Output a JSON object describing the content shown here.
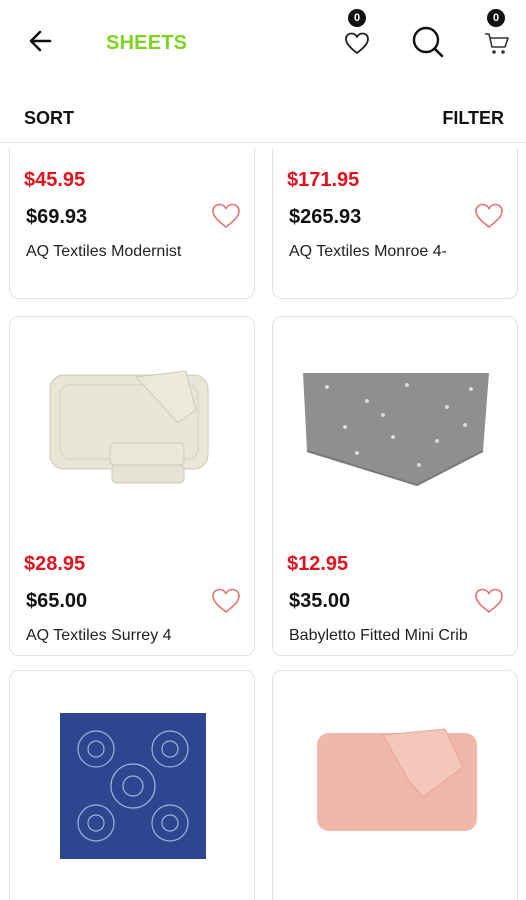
{
  "header": {
    "title": "SHEETS",
    "title_color": "#7ed321",
    "wishlist_count": "0",
    "cart_count": "0",
    "icons": [
      "back-arrow-icon",
      "heart-outline-icon",
      "search-icon",
      "cart-icon"
    ]
  },
  "toolbar": {
    "sort_label": "SORT",
    "filter_label": "FILTER"
  },
  "colors": {
    "sale": "#e3121e",
    "accent_heart": "#e57373"
  },
  "products": [
    {
      "sale_price": "$45.95",
      "price": "$69.93",
      "name": "AQ Textiles Modernist"
    },
    {
      "sale_price": "$171.95",
      "price": "$265.93",
      "name": "AQ Textiles Monroe 4-"
    },
    {
      "sale_price": "$28.95",
      "price": "$65.00",
      "name": "AQ Textiles Surrey 4"
    },
    {
      "sale_price": "$12.95",
      "price": "$35.00",
      "name": "Babyletto Fitted Mini Crib"
    },
    {
      "sale_price": "",
      "price": "",
      "name": ""
    },
    {
      "sale_price": "",
      "price": "",
      "name": ""
    }
  ]
}
